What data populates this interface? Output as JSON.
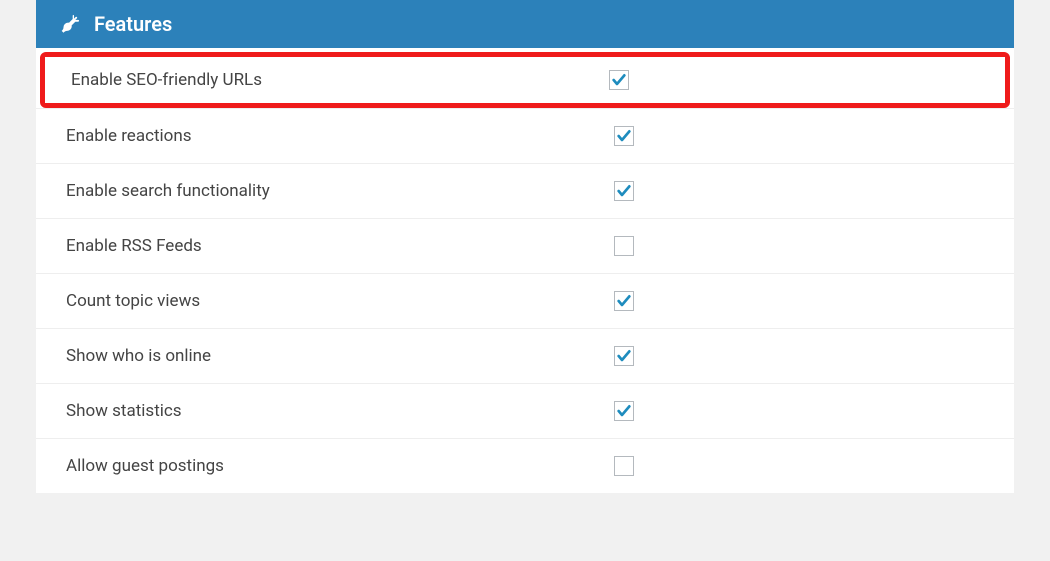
{
  "header": {
    "title": "Features"
  },
  "rows": [
    {
      "label": "Enable SEO-friendly URLs",
      "checked": true,
      "highlight": true
    },
    {
      "label": "Enable reactions",
      "checked": true,
      "highlight": false
    },
    {
      "label": "Enable search functionality",
      "checked": true,
      "highlight": false
    },
    {
      "label": "Enable RSS Feeds",
      "checked": false,
      "highlight": false
    },
    {
      "label": "Count topic views",
      "checked": true,
      "highlight": false
    },
    {
      "label": "Show who is online",
      "checked": true,
      "highlight": false
    },
    {
      "label": "Show statistics",
      "checked": true,
      "highlight": false
    },
    {
      "label": "Allow guest postings",
      "checked": false,
      "highlight": false
    }
  ]
}
